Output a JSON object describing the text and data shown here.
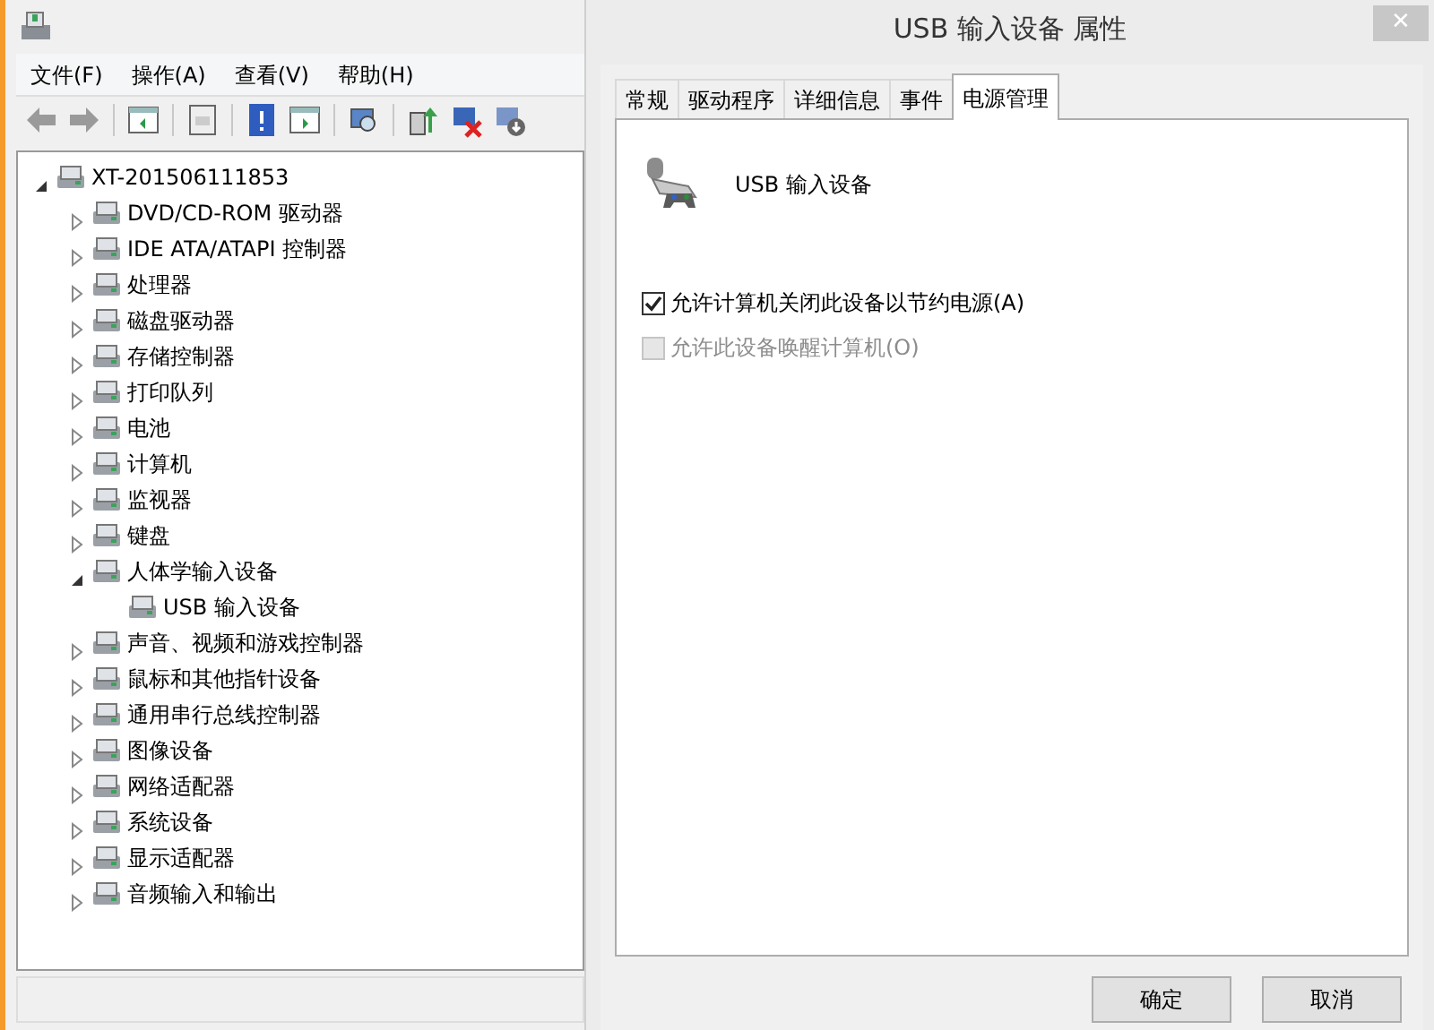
{
  "main_window": {
    "menu": [
      {
        "label": "文件(F)"
      },
      {
        "label": "操作(A)"
      },
      {
        "label": "查看(V)"
      },
      {
        "label": "帮助(H)"
      }
    ],
    "tree": {
      "label": "XT-201506111853",
      "expanded": true,
      "children": [
        {
          "label": "DVD/CD-ROM 驱动器",
          "expanded": false
        },
        {
          "label": "IDE ATA/ATAPI 控制器",
          "expanded": false
        },
        {
          "label": "处理器",
          "expanded": false
        },
        {
          "label": "磁盘驱动器",
          "expanded": false
        },
        {
          "label": "存储控制器",
          "expanded": false
        },
        {
          "label": "打印队列",
          "expanded": false
        },
        {
          "label": "电池",
          "expanded": false
        },
        {
          "label": "计算机",
          "expanded": false
        },
        {
          "label": "监视器",
          "expanded": false
        },
        {
          "label": "键盘",
          "expanded": false
        },
        {
          "label": "人体学输入设备",
          "expanded": true,
          "children": [
            {
              "label": "USB 输入设备"
            }
          ]
        },
        {
          "label": "声音、视频和游戏控制器",
          "expanded": false
        },
        {
          "label": "鼠标和其他指针设备",
          "expanded": false
        },
        {
          "label": "通用串行总线控制器",
          "expanded": false
        },
        {
          "label": "图像设备",
          "expanded": false
        },
        {
          "label": "网络适配器",
          "expanded": false
        },
        {
          "label": "系统设备",
          "expanded": false
        },
        {
          "label": "显示适配器",
          "expanded": false
        },
        {
          "label": "音频输入和输出",
          "expanded": false
        }
      ]
    }
  },
  "dialog": {
    "title": "USB 输入设备 属性",
    "close": "✕",
    "tabs": [
      {
        "label": "常规",
        "selected": false
      },
      {
        "label": "驱动程序",
        "selected": false
      },
      {
        "label": "详细信息",
        "selected": false
      },
      {
        "label": "事件",
        "selected": false
      },
      {
        "label": "电源管理",
        "selected": true
      }
    ],
    "device_name": "USB 输入设备",
    "options": [
      {
        "label": "允许计算机关闭此设备以节约电源(A)",
        "checked": true,
        "disabled": false
      },
      {
        "label": "允许此设备唤醒计算机(O)",
        "checked": false,
        "disabled": true
      }
    ],
    "buttons": [
      {
        "label": "确定"
      },
      {
        "label": "取消"
      }
    ]
  }
}
